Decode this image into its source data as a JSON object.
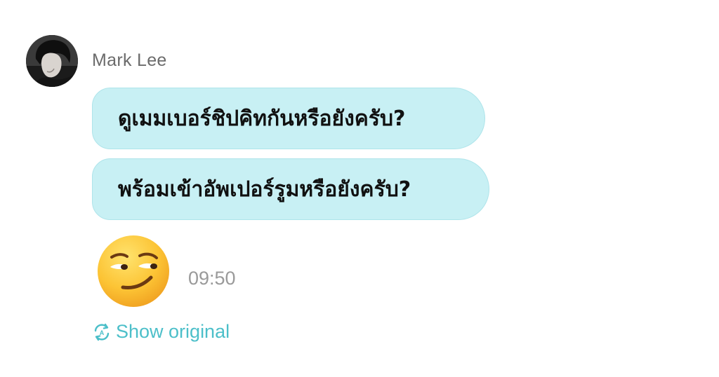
{
  "message": {
    "sender_name": "Mark Lee",
    "bubbles": [
      {
        "text": "ดูเมมเบอร์ชิปคิทกันหรือยังครับ?"
      },
      {
        "text": "พร้อมเข้าอัพเปอร์รูมหรือยังครับ?"
      }
    ],
    "emoji": "smirking-face",
    "timestamp": "09:50"
  },
  "translation": {
    "show_original_label": "Show original",
    "icon": "translate-refresh-icon"
  },
  "colors": {
    "bubble_bg": "#c8f0f4",
    "bubble_border": "#aee4ea",
    "accent": "#4cbfc9",
    "muted_text": "#9a9a9a",
    "name_text": "#6b6b6b"
  }
}
